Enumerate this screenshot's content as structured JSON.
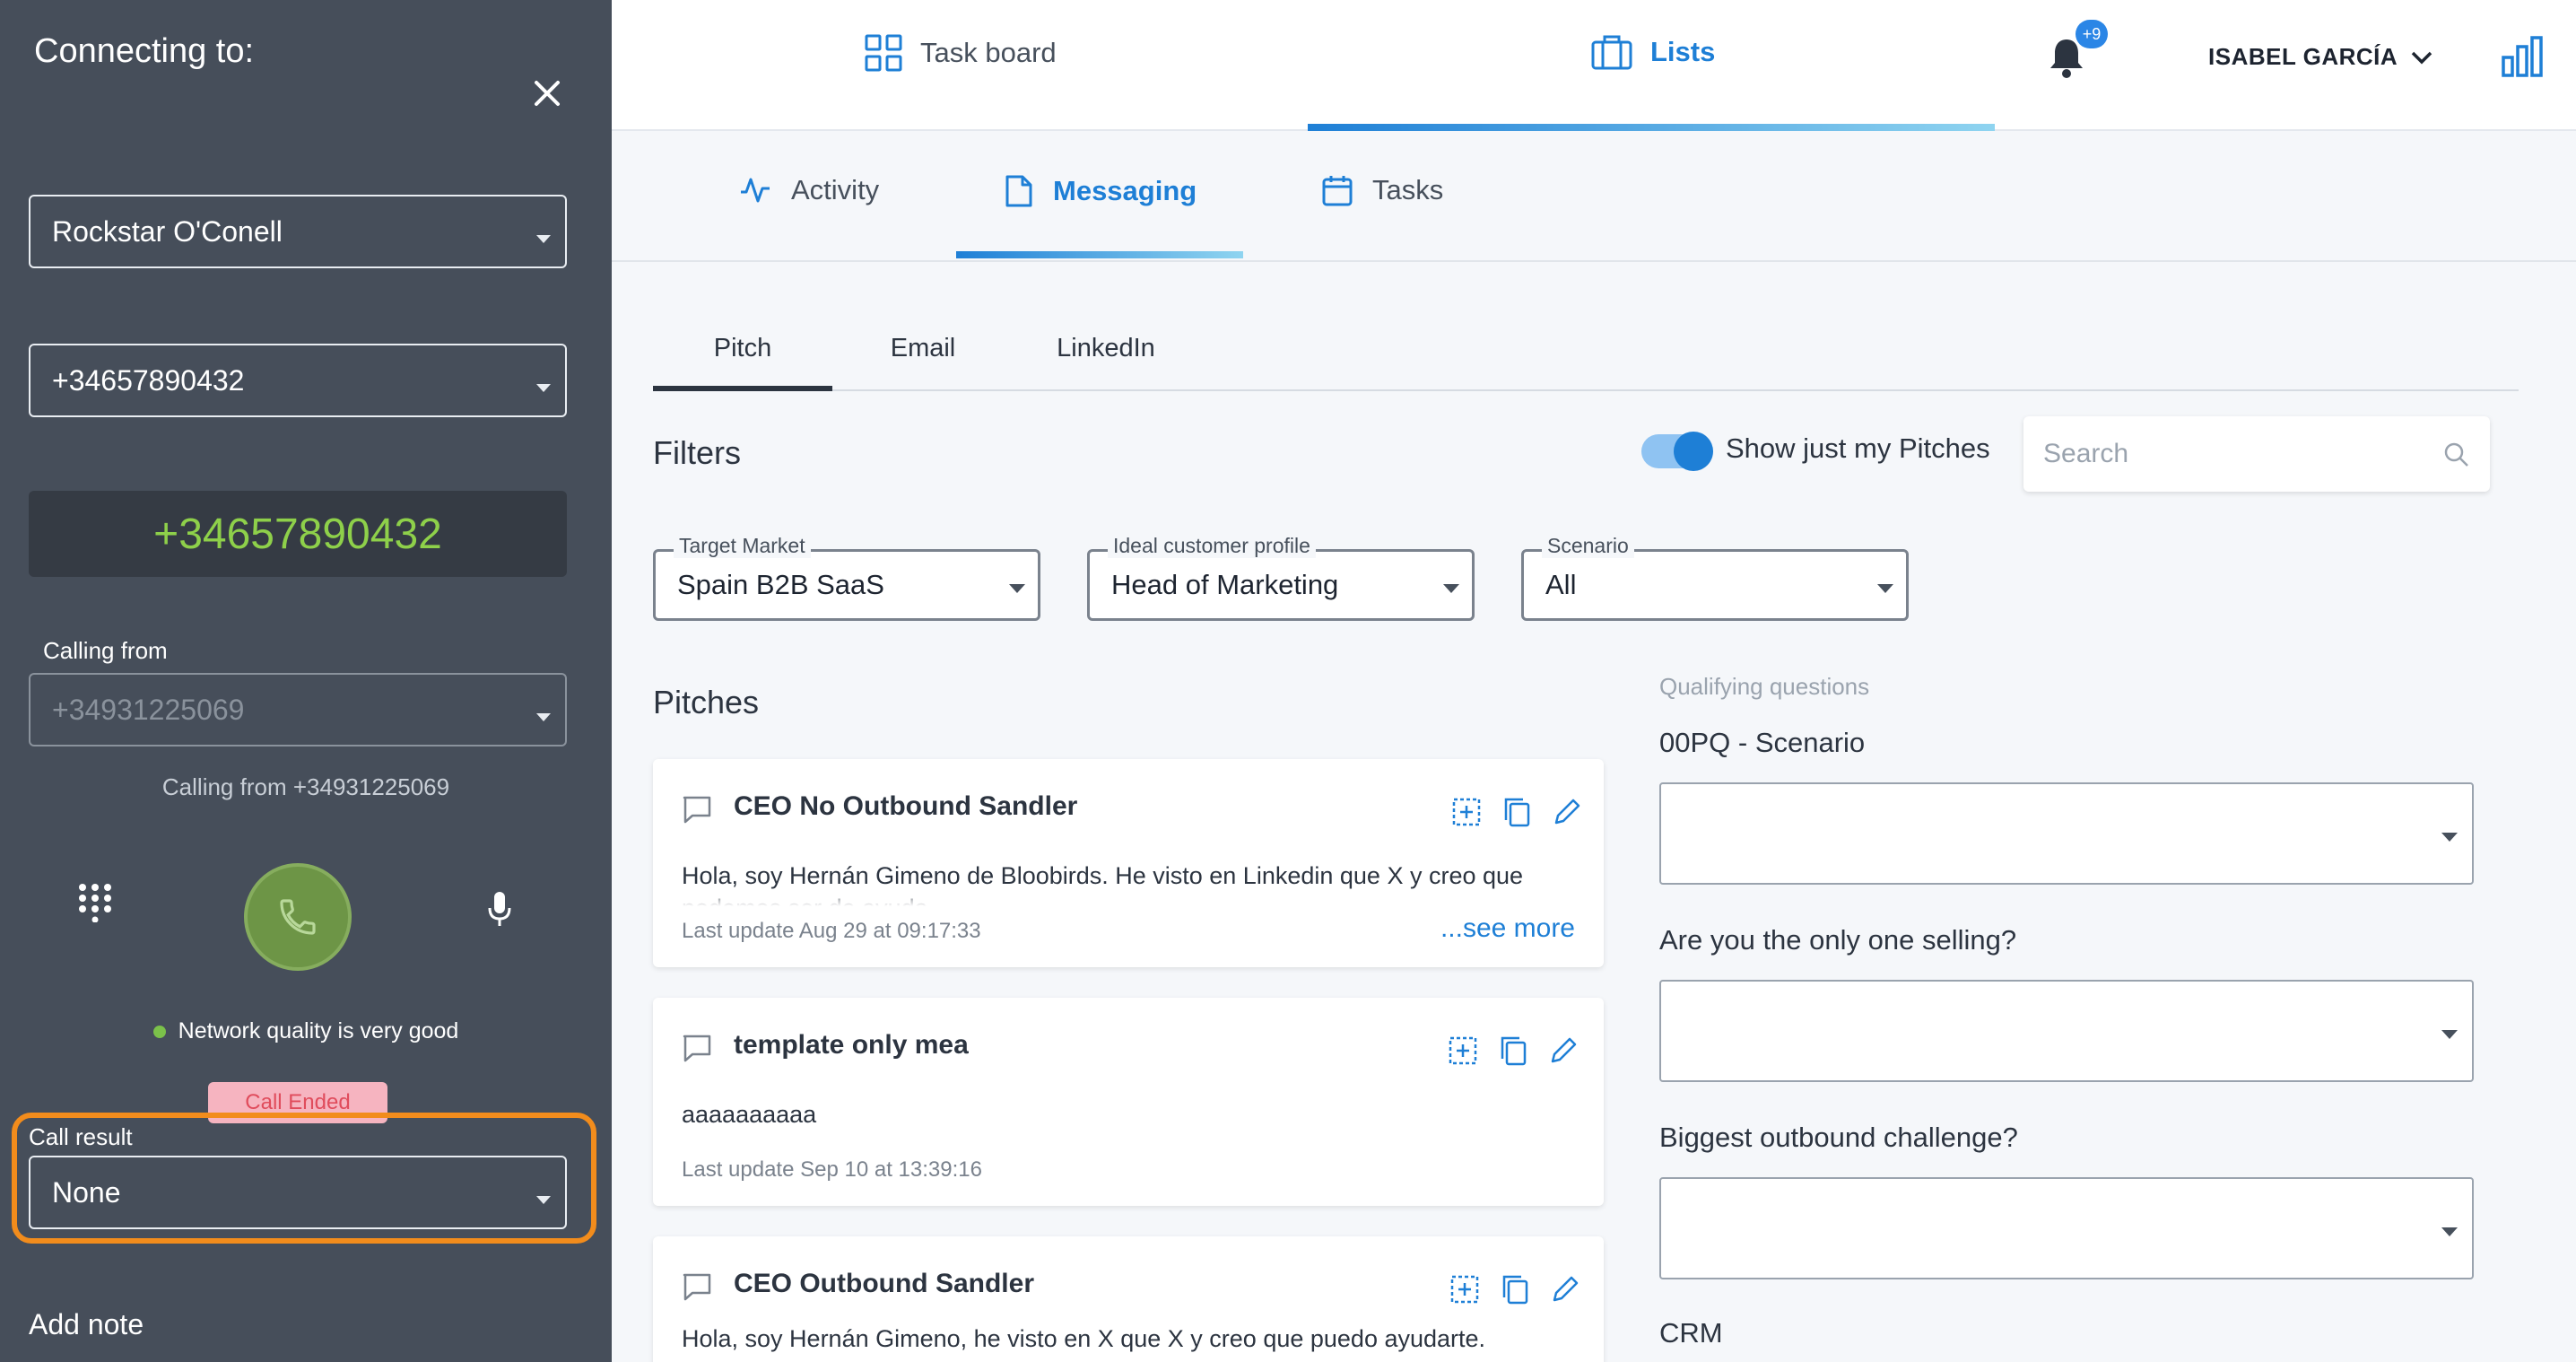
{
  "dialer": {
    "title": "Connecting to:",
    "contact": "Rockstar O'Conell",
    "phone_select": "+34657890432",
    "dialed_number": "+34657890432",
    "calling_from_label": "Calling from",
    "calling_from_value": "+34931225069",
    "calling_from_caption": "Calling from +34931225069",
    "network_status": "Network quality is very good",
    "call_status": "Call Ended",
    "call_result_label": "Call result",
    "call_result_value": "None",
    "add_note": "Add note"
  },
  "topnav": {
    "task_board": "Task board",
    "lists": "Lists",
    "notifications_badge": "+9",
    "user_name": "ISABEL GARCÍA"
  },
  "subnav": {
    "activity": "Activity",
    "messaging": "Messaging",
    "tasks": "Tasks"
  },
  "tabs": [
    "Pitch",
    "Email",
    "LinkedIn"
  ],
  "filters": {
    "title": "Filters",
    "toggle_label": "Show just my Pitches",
    "toggle_on": true,
    "search_placeholder": "Search",
    "target_market_label": "Target Market",
    "target_market_value": "Spain B2B SaaS",
    "icp_label": "Ideal customer profile",
    "icp_value": "Head of Marketing",
    "scenario_label": "Scenario",
    "scenario_value": "All"
  },
  "pitches": {
    "title": "Pitches",
    "items": [
      {
        "name": "CEO No Outbound Sandler",
        "body": "Hola, soy Hernán Gimeno de Bloobirds. He visto en Linkedin que X y creo que podemos ser de ayuda.",
        "meta": "Last update Aug 29 at 09:17:33",
        "see_more": "...see more"
      },
      {
        "name": "template only mea",
        "body": "aaaaaaaaaa",
        "meta": "Last update Sep 10 at 13:39:16"
      },
      {
        "name": "CEO Outbound Sandler",
        "body": "Hola, soy Hernán Gimeno, he visto en X que X y creo que puedo ayudarte."
      }
    ]
  },
  "qualifying": {
    "head": "Qualifying questions",
    "questions": [
      "00PQ - Scenario",
      "Are you the only one selling?",
      "Biggest outbound challenge?",
      "CRM"
    ]
  },
  "colors": {
    "accent": "#1e7fd6",
    "dialer_bg": "#464e5a",
    "number_green": "#8ed04a",
    "highlight_orange": "#f28c1c",
    "call_ended_bg": "#f6b4c0"
  }
}
